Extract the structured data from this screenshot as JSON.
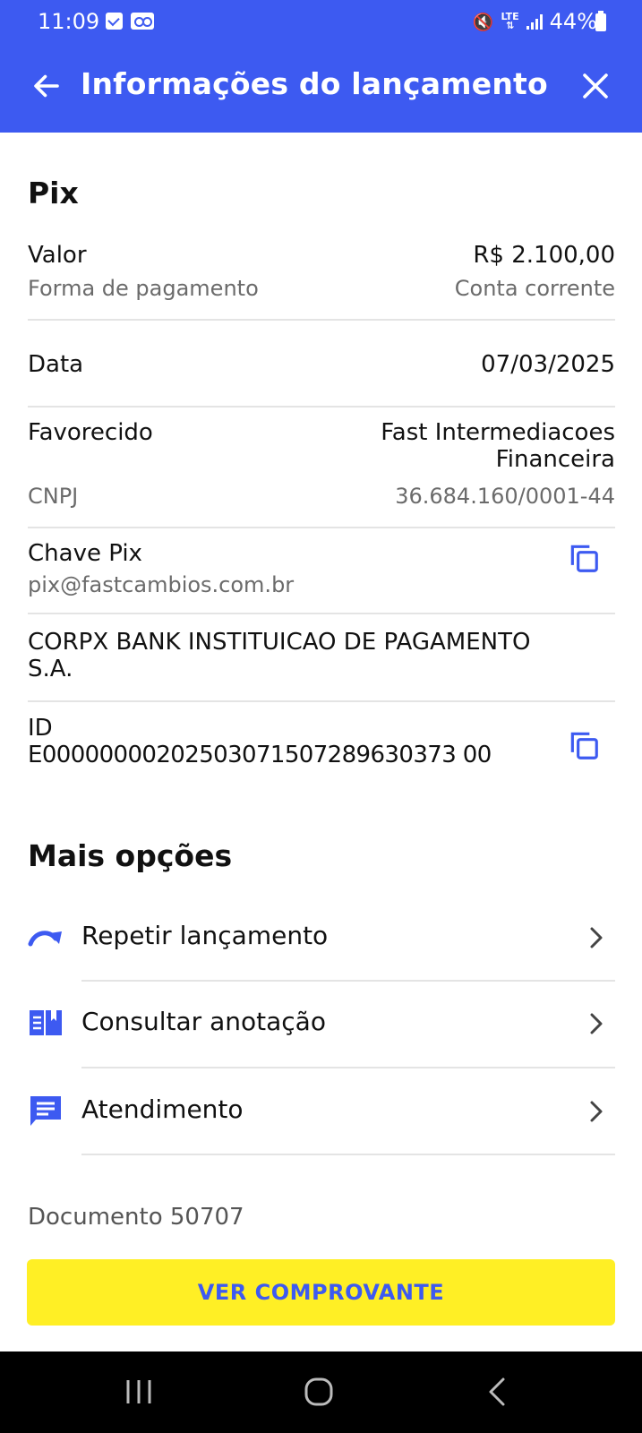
{
  "status_bar": {
    "time": "11:09",
    "battery": "44%",
    "network": "LTE"
  },
  "header": {
    "title": "Informações do lançamento"
  },
  "details": {
    "section_title": "Pix",
    "valor_label": "Valor",
    "valor_value": "R$ 2.100,00",
    "forma_label": "Forma de pagamento",
    "forma_value": "Conta corrente",
    "data_label": "Data",
    "data_value": "07/03/2025",
    "favorecido_label": "Favorecido",
    "favorecido_line1": "Fast Intermediacoes",
    "favorecido_line2": "Financeira",
    "cnpj_label": "CNPJ",
    "cnpj_value": "36.684.160/0001-44",
    "chave_label": "Chave Pix",
    "chave_value": "pix@fastcambios.com.br",
    "bank_line1": "CORPX BANK INSTITUICAO DE PAGAMENTO",
    "bank_line2": "S.A.",
    "id_label": "ID",
    "id_value": "E00000000202503071507289630373 00"
  },
  "more_options": {
    "title": "Mais opções",
    "items": [
      {
        "label": "Repetir lançamento",
        "icon": "repeat-arrow-icon"
      },
      {
        "label": "Consultar anotação",
        "icon": "note-book-icon"
      },
      {
        "label": "Atendimento",
        "icon": "chat-icon"
      }
    ]
  },
  "peek_text": "Documento 50707",
  "footer": {
    "button_label": "VER COMPROVANTE"
  },
  "colors": {
    "primary": "#3d5af1",
    "cta": "#ffef25",
    "divider": "#e4e4e4",
    "muted": "#6b6b6b"
  }
}
